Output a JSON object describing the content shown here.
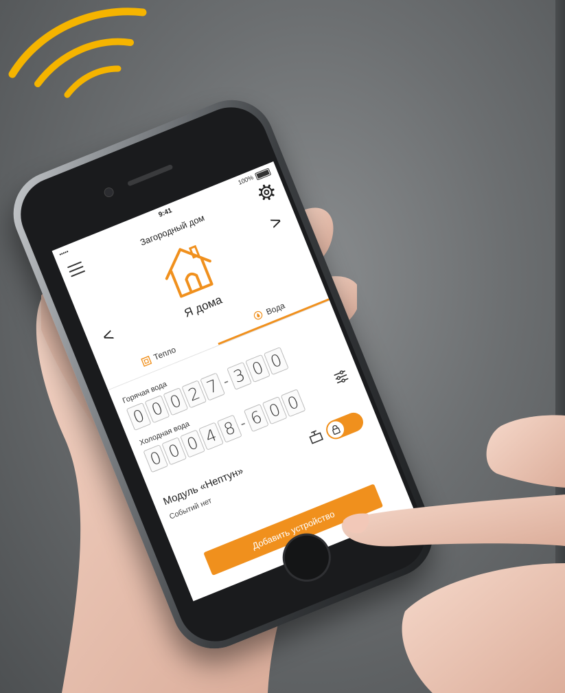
{
  "status_bar": {
    "signal": "•••••",
    "time": "9:41",
    "battery_percent": "100%"
  },
  "header": {
    "title": "Загородный дом"
  },
  "mode": {
    "label": "Я дома"
  },
  "tabs": [
    {
      "label": "Тепло",
      "icon": "radiator-icon",
      "active": false
    },
    {
      "label": "Вода",
      "icon": "water-drop-icon",
      "active": true
    }
  ],
  "meters": [
    {
      "label": "Горячая вода",
      "integer_digits": [
        "0",
        "0",
        "0",
        "2",
        "7"
      ],
      "fraction_digits": [
        "3",
        "0",
        "0"
      ]
    },
    {
      "label": "Холодная вода",
      "integer_digits": [
        "0",
        "0",
        "0",
        "4",
        "8"
      ],
      "fraction_digits": [
        "6",
        "0",
        "0"
      ]
    }
  ],
  "module": {
    "name": "Модуль «Нептун»",
    "events": "Событий нет",
    "toggle_on": true
  },
  "actions": {
    "add_device": "Добавить устройство"
  },
  "colors": {
    "accent": "#f0901d",
    "wifi": "#f5b400"
  }
}
